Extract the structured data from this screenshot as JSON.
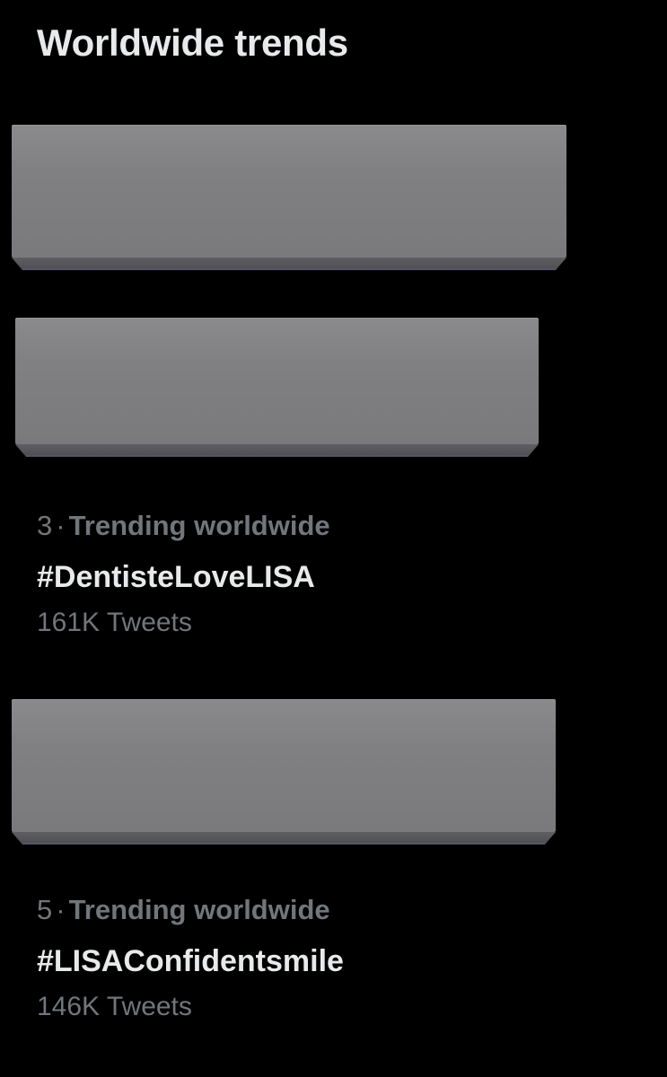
{
  "header": {
    "title": "Worldwide trends"
  },
  "trends": [
    {
      "rank": "3",
      "separator": "·",
      "context": "Trending worldwide",
      "name": "#DentisteLoveLISA",
      "count": "161K Tweets"
    },
    {
      "rank": "5",
      "separator": "·",
      "context": "Trending worldwide",
      "name": "#LISAConfidentsmile",
      "count": "146K Tweets"
    }
  ],
  "colors": {
    "background": "#000000",
    "primary_text": "#e7e9ea",
    "secondary_text": "#71767b",
    "redaction_block": "#808082"
  }
}
